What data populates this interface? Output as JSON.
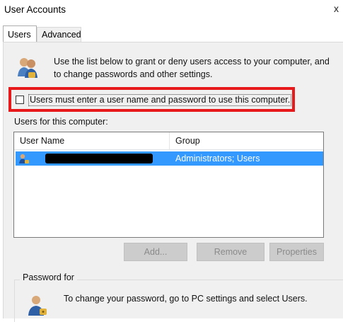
{
  "window": {
    "title": "User Accounts",
    "close_glyph": "x"
  },
  "tabs": [
    {
      "label": "Users",
      "active": true
    },
    {
      "label": "Advanced",
      "active": false
    }
  ],
  "users_tab": {
    "intro_text": "Use the list below to grant or deny users access to your computer, and to change passwords and other settings.",
    "require_login": {
      "label": "Users must enter a user name and password to use this computer.",
      "checked": false,
      "highlight_color": "#e8191b"
    },
    "users_list": {
      "caption": "Users for this computer:",
      "columns": [
        "User Name",
        "Group"
      ],
      "rows": [
        {
          "user_name": "",
          "user_name_redacted": true,
          "group": "Administrators; Users",
          "selected": true
        }
      ],
      "selection_color": "#3399ff"
    },
    "buttons": {
      "add": "Add...",
      "remove": "Remove",
      "properties": "Properties"
    },
    "password": {
      "legend": "Password for",
      "text": "To change your password, go to PC settings and select Users."
    }
  },
  "icons": {
    "users_icon": "users-icon",
    "user_row_icon": "user-icon",
    "password_icon": "user-key-icon"
  }
}
